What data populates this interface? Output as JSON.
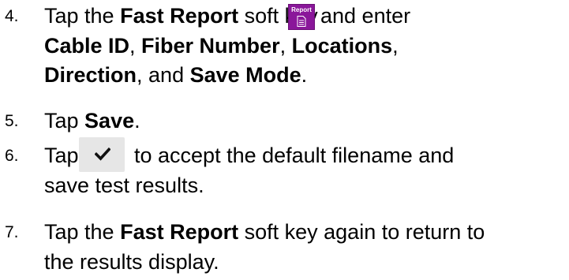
{
  "steps": [
    {
      "number": "4.",
      "line1_pre": "Tap the ",
      "line1_bold": "Fast Report",
      "line1_post": " soft key",
      "softkey_label": "Report",
      "softkey_icon": "document-icon",
      "line1_tail": "and enter",
      "line2_parts": [
        "Cable ID",
        ", ",
        "Fiber Number",
        ", ",
        "Locations",
        ","
      ],
      "line3_parts": [
        "Direction",
        ", and ",
        "Save Mode",
        "."
      ]
    },
    {
      "number": "5.",
      "pre": "Tap ",
      "bold": "Save",
      "post": "."
    },
    {
      "number": "6.",
      "pre": "Tap",
      "button_icon": "checkmark-icon",
      "post": "to accept the default filename and",
      "line2": "save test results."
    },
    {
      "number": "7.",
      "pre": "Tap the ",
      "bold": "Fast Report",
      "post": " soft key again to return to",
      "line2": "the results display."
    }
  ],
  "colors": {
    "softkey_bg": "#8a179a",
    "button_bg": "#e6e6e6"
  }
}
